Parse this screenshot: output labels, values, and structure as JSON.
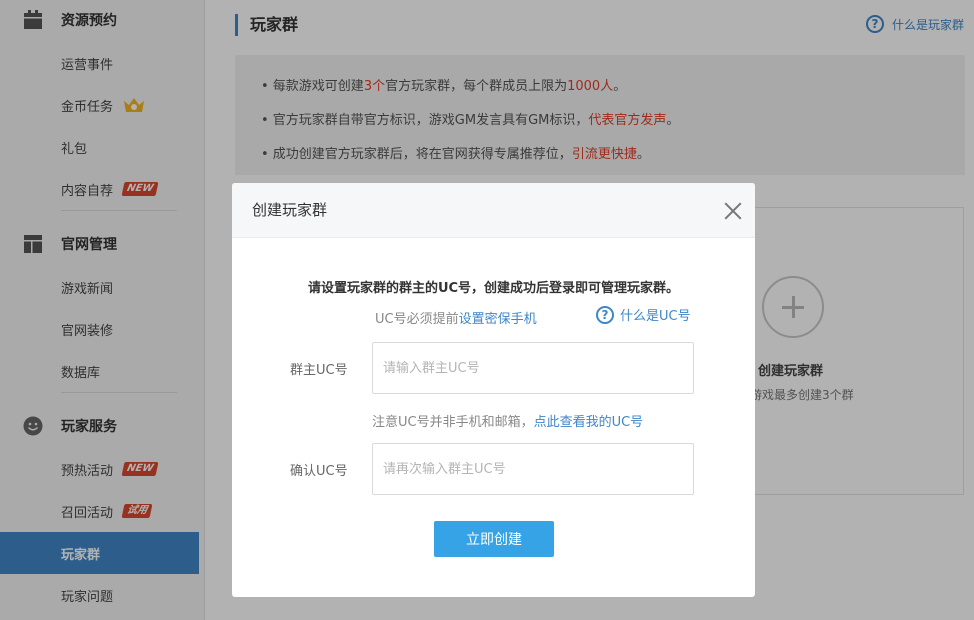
{
  "sidebar": {
    "sections": [
      {
        "label": "资源预约",
        "icon": "calendar-icon"
      },
      {
        "label": "官网管理",
        "icon": "layout-icon"
      },
      {
        "label": "玩家服务",
        "icon": "smiley-icon"
      }
    ],
    "items": [
      {
        "label": "运营事件"
      },
      {
        "label": "金币任务",
        "badge_icon": "crown-icon"
      },
      {
        "label": "礼包"
      },
      {
        "label": "内容自荐",
        "badge": "NEW"
      },
      {
        "label": "游戏新闻"
      },
      {
        "label": "官网装修"
      },
      {
        "label": "数据库"
      },
      {
        "label": "预热活动",
        "badge": "NEW"
      },
      {
        "label": "召回活动",
        "badge": "试用"
      },
      {
        "label": "玩家群",
        "active": true
      },
      {
        "label": "玩家问题"
      }
    ]
  },
  "main": {
    "title": "玩家群",
    "help_link": "什么是玩家群",
    "notice": [
      {
        "pre": "• 每款游戏可创建",
        "red1": "3个",
        "mid": "官方玩家群，每个群成员上限为",
        "red2": "1000人",
        "post": "。"
      },
      {
        "pre": "• 官方玩家群自带官方标识，游戏GM发言具有GM标识，",
        "red1": "代表官方发声",
        "mid": "",
        "red2": "",
        "post": "。"
      },
      {
        "pre": "• 成功创建官方玩家群后，将在官网获得专属推荐位，",
        "red1": "引流更快捷",
        "mid": "",
        "red2": "",
        "post": "。"
      }
    ],
    "create_card": {
      "title": "创建玩家群",
      "subtitle": "游戏最多创建3个群"
    }
  },
  "modal": {
    "title": "创建玩家群",
    "intro": "请设置玩家群的群主的UC号，创建成功后登录即可管理玩家群。",
    "hint1_prefix": "UC号必须提前",
    "hint1_link": "设置密保手机",
    "help_link": "什么是UC号",
    "owner_label": "群主UC号",
    "owner_placeholder": "请输入群主UC号",
    "owner_value": "",
    "hint2_prefix": "注意UC号并非手机和邮箱，",
    "hint2_link": "点此查看我的UC号",
    "confirm_label": "确认UC号",
    "confirm_placeholder": "请再次输入群主UC号",
    "confirm_value": "",
    "submit_label": "立即创建"
  },
  "colors": {
    "accent": "#3f86c8",
    "button": "#35a3e6",
    "badge": "#d9472e",
    "highlight": "#e23d28"
  }
}
